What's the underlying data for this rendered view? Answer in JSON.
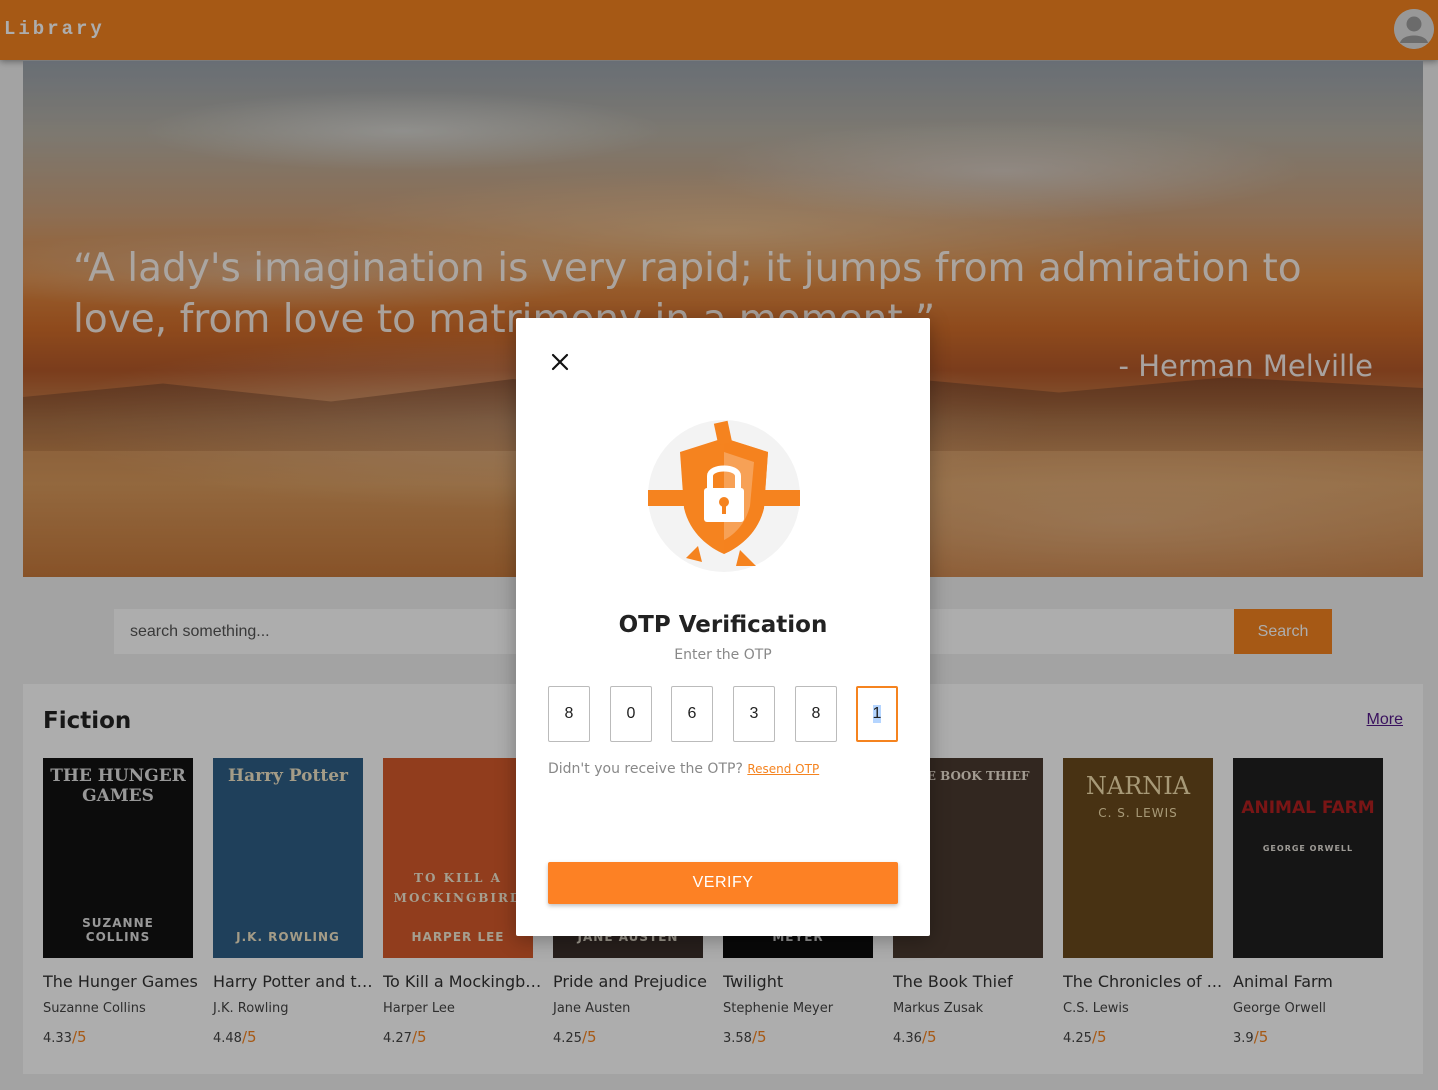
{
  "header": {
    "brand": "Library",
    "avatar_icon": "user-avatar-icon"
  },
  "hero": {
    "quote": "“A lady's imagination is very rapid; it jumps from admiration to love, from love to matrimony in a moment.”",
    "author": "- Herman Melville"
  },
  "search": {
    "placeholder": "search something...",
    "value": "",
    "button_label": "Search"
  },
  "section": {
    "title": "Fiction",
    "more_label": "More",
    "books": [
      {
        "title": "The Hunger Games",
        "author": "Suzanne Collins",
        "rating": "4.33",
        "denom": "/5",
        "cover_text": "THE HUNGER GAMES",
        "cover_author": "SUZANNE COLLINS",
        "cover_color": "#121212",
        "cover_fg": "#e0e0e0"
      },
      {
        "title": "Harry Potter and th...",
        "author": "J.K. Rowling",
        "rating": "4.48",
        "denom": "/5",
        "cover_text": "Harry Potter",
        "cover_author": "J.K. ROWLING",
        "cover_color": "#2f5f86",
        "cover_fg": "#f2e6c8"
      },
      {
        "title": "To Kill a Mockingbird",
        "author": "Harper Lee",
        "rating": "4.27",
        "denom": "/5",
        "cover_text": "TO KILL A MOCKINGBIRD",
        "cover_author": "HARPER LEE",
        "cover_color": "#d65a2c",
        "cover_fg": "#f4ead4"
      },
      {
        "title": "Pride and Prejudice",
        "author": "Jane Austen",
        "rating": "4.25",
        "denom": "/5",
        "cover_text": "",
        "cover_author": "JANE AUSTEN",
        "cover_color": "#3a2f2a",
        "cover_fg": "#e8e0d0"
      },
      {
        "title": "Twilight",
        "author": "Stephenie Meyer",
        "rating": "3.58",
        "denom": "/5",
        "cover_text": "",
        "cover_author": "STEPHENIE MEYER",
        "cover_color": "#0d0d0d",
        "cover_fg": "#d8d8d8"
      },
      {
        "title": "The Book Thief",
        "author": "Markus Zusak",
        "rating": "4.36",
        "denom": "/5",
        "cover_text": "THE BOOK THIEF",
        "cover_author": "",
        "cover_color": "#4a3a30",
        "cover_fg": "#f0e6d8"
      },
      {
        "title": "The Chronicles of ...",
        "author": "C.S. Lewis",
        "rating": "4.25",
        "denom": "/5",
        "cover_text": "NARNIA",
        "cover_author": "C. S. LEWIS",
        "cover_color": "#6b4a1c",
        "cover_fg": "#f6e2b0"
      },
      {
        "title": "Animal Farm",
        "author": "George Orwell",
        "rating": "3.9",
        "denom": "/5",
        "cover_text": "ANIMAL FARM",
        "cover_author": "GEORGE ORWELL",
        "cover_color": "#1f1f1f",
        "cover_fg": "#e8e4dc"
      }
    ]
  },
  "modal": {
    "close_icon": "close-icon",
    "illustration_icon": "shield-lock-icon",
    "title": "OTP Verification",
    "subtitle": "Enter the OTP",
    "otp_digits": [
      "8",
      "0",
      "6",
      "3",
      "8",
      "1"
    ],
    "resend_prompt": "Didn't you receive the OTP?",
    "resend_label": "Resend OTP",
    "verify_label": "VERIFY"
  },
  "colors": {
    "accent": "#f5831f",
    "link_visited": "#551a8b"
  }
}
